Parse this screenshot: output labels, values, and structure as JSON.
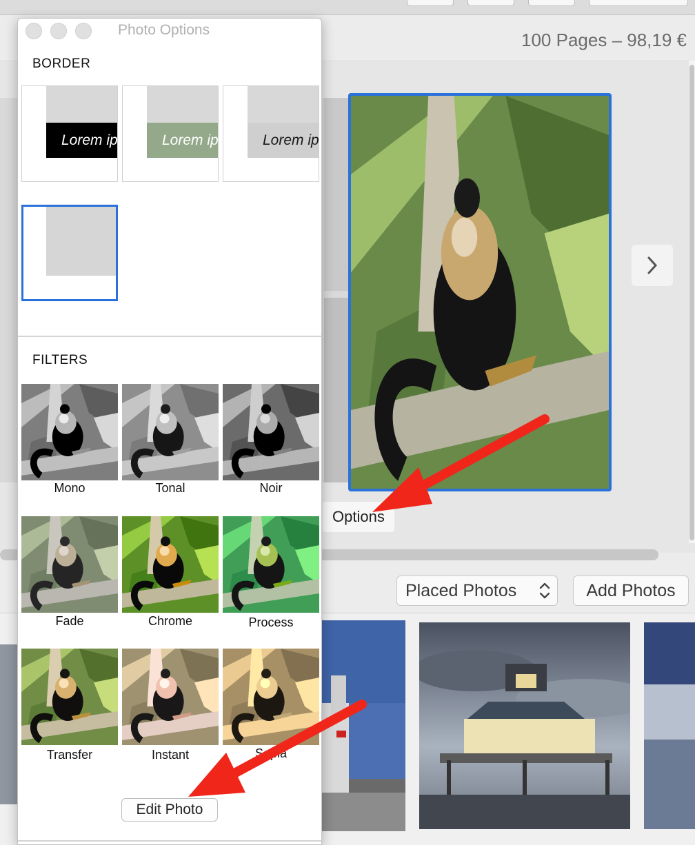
{
  "header": {
    "page_info": "100 Pages – 98,19 €"
  },
  "canvas": {
    "options_label": "Options",
    "next_icon": "chevron-right-icon"
  },
  "photos_toolbar": {
    "source_select": "Placed Photos",
    "add_label": "Add Photos"
  },
  "panel": {
    "title": "Photo Options",
    "border_section": "BORDER",
    "border_options": [
      {
        "caption": "Lorem ip",
        "caption_bg": "#000000",
        "caption_color": "#ffffff"
      },
      {
        "caption": "Lorem ip",
        "caption_bg": "#93a98a",
        "caption_color": "#ffffff"
      },
      {
        "caption": "Lorem ip",
        "caption_bg": "#cfcfcf",
        "caption_color": "#1a1a1a"
      },
      {
        "caption": "",
        "selected": true
      }
    ],
    "filters_section": "FILTERS",
    "filters": [
      "Mono",
      "Tonal",
      "Noir",
      "Fade",
      "Chrome",
      "Process",
      "Transfer",
      "Instant",
      "Sepia"
    ],
    "edit_label": "Edit Photo"
  },
  "colors": {
    "selection_blue": "#2a72d9",
    "annotation_red": "#f0261b"
  }
}
